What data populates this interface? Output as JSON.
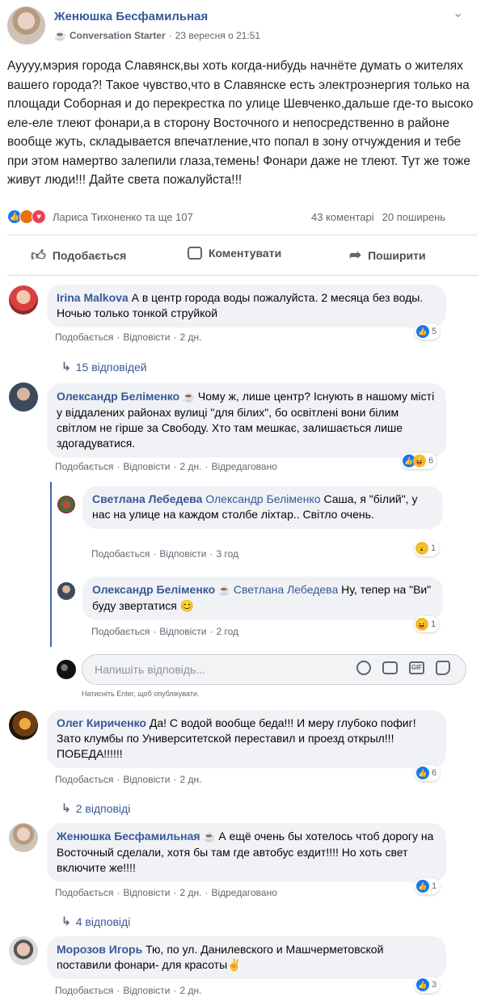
{
  "post": {
    "author": "Женюшка Бесфамильная",
    "badge": "Conversation Starter",
    "time": "23 вересня о 21:51",
    "text": "Ауууу,мэрия города Славянск,вы хоть когда-нибудь начнёте думать о жителях вашего города?! Такое чувство,что в Славянске есть электроэнергия только на площади Соборная и до перекрестка по улице Шевченко,дальше где-то высоко еле-еле тлеют фонари,а в сторону Восточного и непосредственно в районе вообще жуть, складывается впечатление,что попал в зону отчуждения и тебе при этом намертво залепили глаза,темень! Фонари даже не тлеют. Тут же тоже живут люди!!! Дайте света пожалуйста!!!",
    "reactors": "Лариса Тихоненко та ще 107",
    "comments_count": "43 коментарі",
    "shares_count": "20 поширень"
  },
  "actions": {
    "like": "Подобається",
    "comment": "Коментувати",
    "share": "Поширити"
  },
  "meta_labels": {
    "like": "Подобається",
    "reply": "Відповісти",
    "edited": "Відредаговано"
  },
  "comments": [
    {
      "author": "Irina Malkova",
      "text": "А в центр города воды пожалуйста. 2 месяца без воды. Ночью только тонкой струйкой",
      "time": "2 дн.",
      "reactions": "5",
      "replies": "15 відповідей"
    },
    {
      "author": "Олександр Беліменко",
      "text": "Чому ж, лише центр? Існують в нашому місті у віддалених районах вулиці \"для білих\", бо освітлені вони білим світлом не гірше за Свободу. Хто там мешкає, залишається лише здогадуватися.",
      "time": "2 дн.",
      "reactions": "6"
    },
    {
      "author": "Олег Кириченко",
      "text": "Да! С водой вообще беда!!! И меру глубоко пофиг! Зато клумбы по Университетской переставил и проезд открыл!!! ПОБЕДА!!!!!!",
      "time": "2 дн.",
      "reactions": "6",
      "replies": "2 відповіді"
    },
    {
      "author": "Женюшка Бесфамильная",
      "text": "А ещё очень бы хотелось чтоб дорогу на Восточный сделали, хотя бы там где автобус ездит!!!! Но хоть свет включите же!!!!",
      "time": "2 дн.",
      "reactions": "1",
      "replies": "4 відповіді"
    },
    {
      "author": "Морозов Игорь",
      "text": "Тю, по ул. Данилевского и Машчерметовской поставили фонари- для красоты✌️",
      "time": "2 дн.",
      "reactions": "3"
    }
  ],
  "replies": [
    {
      "author": "Светлана Лебедева",
      "mention": "Олександр Беліменко",
      "text": "Саша, я \"білий\", у нас на улице на каждом столбе ліхтар.. Світло очень.",
      "time": "3 год",
      "reactions": "1"
    },
    {
      "author": "Олександр Беліменко",
      "mention": "Светлана Лебедева",
      "text": "Ну, тепер на \"Ви\" буду звертатися 😊",
      "time": "2 год",
      "reactions": "1"
    }
  ],
  "reply_box": {
    "placeholder": "Напишіть відповідь...",
    "hint": "Натисніть Enter, щоб опублікувати."
  },
  "colors": {
    "link": "#385898",
    "like_blue": "#1877f2",
    "bubble_bg": "#f0f2f5"
  }
}
